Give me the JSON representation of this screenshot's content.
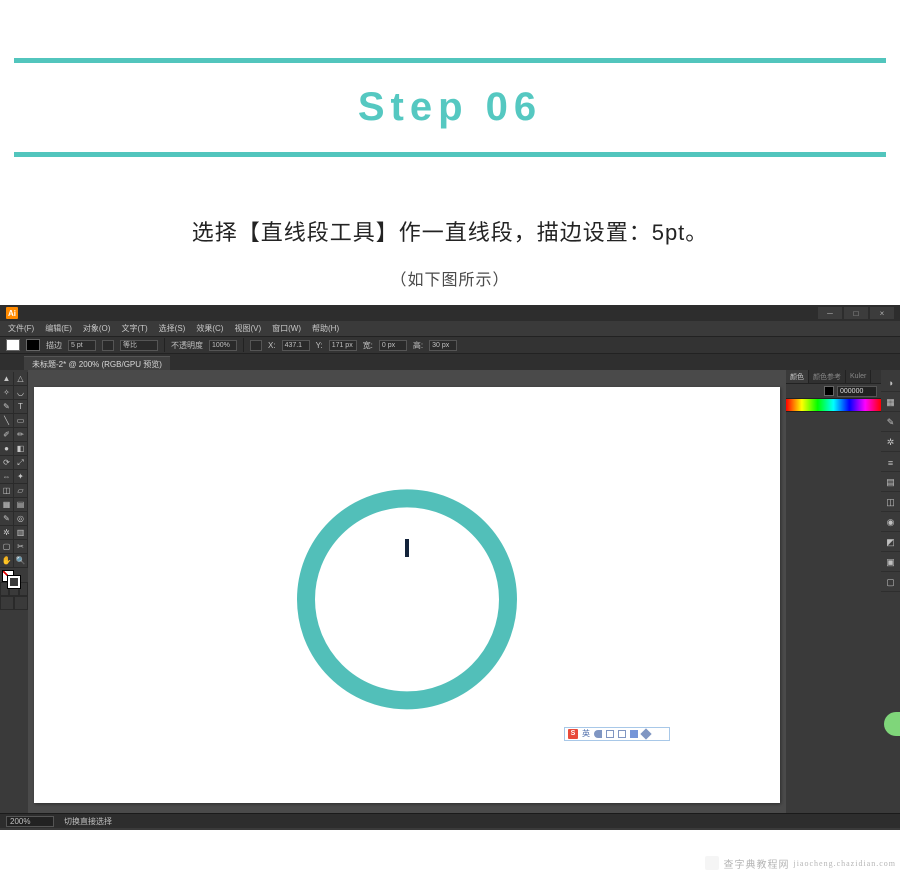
{
  "heading": {
    "title": "Step 06"
  },
  "instruction": {
    "text": "选择【直线段工具】作一直线段，描边设置：5pt。",
    "note": "（如下图所示）"
  },
  "ai": {
    "logo": "Ai",
    "menubar": [
      "文件(F)",
      "编辑(E)",
      "对象(O)",
      "文字(T)",
      "选择(S)",
      "效果(C)",
      "视图(V)",
      "窗口(W)",
      "帮助(H)"
    ],
    "controlbar": {
      "stroke_label": "描边",
      "stroke_pt": "5 pt",
      "style": "等比",
      "opacity_label": "不透明度",
      "opacity_val": "100%",
      "x": "437.1",
      "y": "171 px",
      "w": "0 px",
      "h": "30 px"
    },
    "doc_tab": "未标题-2* @ 200% (RGB/GPU 预览)",
    "panel": {
      "tabs": [
        "颜色",
        "颜色参考",
        "Kuler"
      ],
      "hex": "000000"
    },
    "statusbar": {
      "zoom": "200%",
      "hint": "切换直接选择"
    },
    "sogou": {
      "label": "英"
    }
  },
  "watermark": {
    "text": "查字典教程网",
    "url": "jiaocheng.chazidian.com"
  }
}
